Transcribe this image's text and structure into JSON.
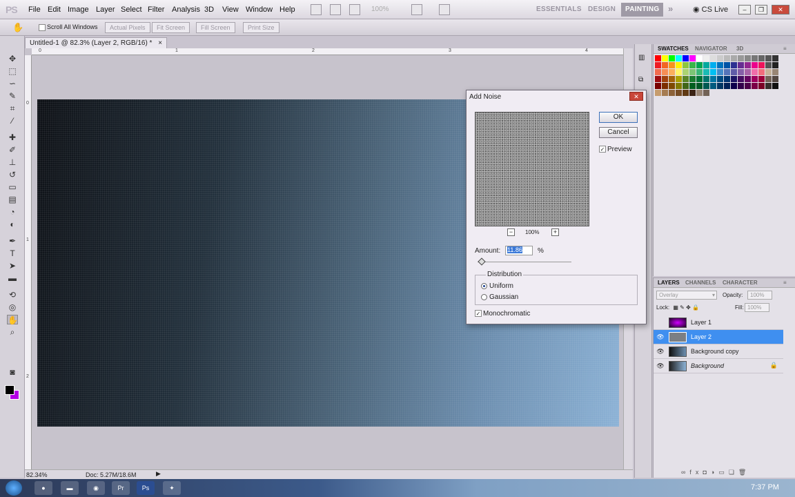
{
  "app": {
    "logo": "PS"
  },
  "menu": [
    "File",
    "Edit",
    "Image",
    "Layer",
    "Select",
    "Filter",
    "Analysis",
    "3D",
    "View",
    "Window",
    "Help"
  ],
  "zoom_dropdown": "100%",
  "workspaces": {
    "essentials": "ESSENTIALS",
    "design": "DESIGN",
    "painting": "PAINTING",
    "more": "»"
  },
  "cs_live": "CS Live",
  "options_bar": {
    "scroll_all_label": "Scroll All Windows",
    "actual_pixels": "Actual Pixels",
    "fit_screen": "Fit Screen",
    "fill_screen": "Fill Screen",
    "print_size": "Print Size"
  },
  "document": {
    "tab_title": "Untitled-1 @ 82.3% (Layer 2, RGB/16) *",
    "ruler_h_labels": [
      "0",
      "1",
      "2",
      "3",
      "4"
    ],
    "ruler_v_labels": [
      "0",
      "1",
      "2"
    ]
  },
  "status": {
    "zoom": "82.34%",
    "doc_size": "Doc: 5.27M/18.6M"
  },
  "swatches_panel": {
    "tabs": [
      "SWATCHES",
      "NAVIGATOR",
      "3D"
    ],
    "colors": [
      "#ff0000",
      "#ffff00",
      "#00ff00",
      "#00ffff",
      "#0000ff",
      "#ff00ff",
      "#ffffff",
      "#eeeeee",
      "#dddddd",
      "#cccccc",
      "#bbbbbb",
      "#aaaaaa",
      "#999999",
      "#888888",
      "#777777",
      "#666666",
      "#555555",
      "#333333",
      "#ee1c24",
      "#f26522",
      "#f7941d",
      "#fff200",
      "#8dc63f",
      "#39b54a",
      "#00a651",
      "#00a99d",
      "#00aeef",
      "#0072bc",
      "#0054a6",
      "#2e3192",
      "#662d91",
      "#92278f",
      "#ec008c",
      "#ed145b",
      "#555555",
      "#222222",
      "#f26c4f",
      "#f68e55",
      "#fbaf5c",
      "#fff467",
      "#acd372",
      "#7cc576",
      "#3bb878",
      "#1abbb4",
      "#00bff3",
      "#438ccb",
      "#5574b9",
      "#605ca8",
      "#855fa8",
      "#a763a8",
      "#f06eaa",
      "#f26d7d",
      "#c7b299",
      "#998675",
      "#9e0b0f",
      "#a0410d",
      "#a3620a",
      "#aba000",
      "#598527",
      "#197b30",
      "#007236",
      "#00746b",
      "#0076a3",
      "#004a80",
      "#003471",
      "#1b1464",
      "#440e62",
      "#630460",
      "#9e005d",
      "#9e0039",
      "#736357",
      "#534741",
      "#790000",
      "#7b2e00",
      "#7d4900",
      "#827b00",
      "#406618",
      "#005e20",
      "#005826",
      "#005952",
      "#005b7f",
      "#003663",
      "#002157",
      "#0d004c",
      "#32004b",
      "#4b0049",
      "#7b0046",
      "#7a0026",
      "#362f2d",
      "#111111",
      "#c69c6d",
      "#a67c52",
      "#8c6239",
      "#754c24",
      "#603913",
      "#3c2415",
      "#998675",
      "#736357"
    ]
  },
  "layers_panel": {
    "tabs": [
      "LAYERS",
      "CHANNELS",
      "CHARACTER"
    ],
    "blend_mode": "Overlay",
    "opacity_label": "Opacity:",
    "opacity_value": "100%",
    "lock_label": "Lock:",
    "fill_label": "Fill:",
    "fill_value": "100%",
    "layers": [
      {
        "name": "Layer 1",
        "visible": false,
        "selected": false,
        "locked": false,
        "thumb": "#3a0040"
      },
      {
        "name": "Layer 2",
        "visible": true,
        "selected": true,
        "locked": false,
        "thumb": "#7b7f84"
      },
      {
        "name": "Background copy",
        "visible": true,
        "selected": false,
        "locked": false,
        "thumb": "#4a6a8a"
      },
      {
        "name": "Background",
        "visible": true,
        "selected": false,
        "locked": true,
        "thumb": "#5a7a9a"
      }
    ]
  },
  "dialog": {
    "title": "Add Noise",
    "ok": "OK",
    "cancel": "Cancel",
    "preview_label": "Preview",
    "zoom_level": "100%",
    "amount_label": "Amount:",
    "amount_value": "11.86",
    "amount_unit": "%",
    "distribution_label": "Distribution",
    "uniform_label": "Uniform",
    "gaussian_label": "Gaussian",
    "monochromatic_label": "Monochromatic",
    "distribution_selected": "Uniform",
    "preview_checked": true,
    "monochromatic_checked": true
  },
  "taskbar": {
    "clock": "7:37 PM"
  },
  "colors": {
    "foreground": "#000000",
    "background": "#b400e6",
    "selection": "#3f8ff0"
  }
}
